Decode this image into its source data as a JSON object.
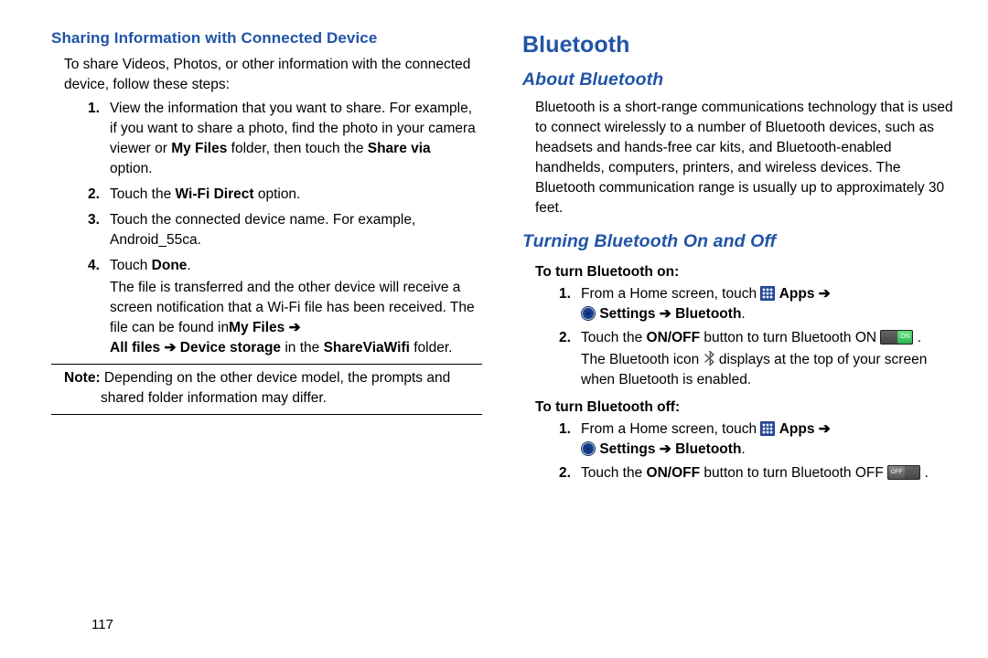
{
  "left": {
    "heading": "Sharing Information with Connected Device",
    "intro": "To share Videos, Photos, or other information with the connected device, follow these steps:",
    "step1": "View the information that you want to share. For example, if you want to share a photo, find the photo in your camera viewer or ",
    "myFiles": "My Files",
    "step1b": " folder, then touch the ",
    "shareVia": "Share via",
    "step1c": " option.",
    "step2a": "Touch the ",
    "wifiDirect": "Wi-Fi Direct",
    "step2b": " option.",
    "step3": "Touch the connected device name. For example, Android_55ca.",
    "step4a": "Touch ",
    "done": "Done",
    "step4b": ".",
    "step4cont": "The file is transferred and the other device will receive a screen notification that a Wi-Fi file has been received. The file can be found in",
    "myFiles2": "My Files",
    "arrow": "➔",
    "allFiles": "All files",
    "deviceStorage": "Device storage",
    "inThe": " in the ",
    "shareViaWifi": "ShareViaWifi",
    "folder": " folder.",
    "noteLabel": "Note: ",
    "noteFirst": "Depending on the other device model, the prompts and",
    "noteBody": "shared folder information may differ.",
    "pageNum": "117"
  },
  "right": {
    "main": "Bluetooth",
    "about": "About Bluetooth",
    "aboutText": "Bluetooth is a short-range communications technology that is used to connect wirelessly to a number of Bluetooth devices, such as headsets and hands-free car kits, and Bluetooth-enabled handhelds, computers, printers, and wireless devices. The Bluetooth communication range is usually up to approximately 30 feet.",
    "turning": "Turning Bluetooth On and Off",
    "toOn": "To turn Bluetooth on:",
    "fromHome": "From a Home screen, touch ",
    "apps": "Apps",
    "settings": "Settings",
    "bluetooth": "Bluetooth",
    "touchThe": "Touch the ",
    "onoff": "ON/OFF",
    "toTurnOn": " button to turn Bluetooth ON ",
    "btIconTxt": "The Bluetooth icon ",
    "displaysTop": " displays at the top of your screen when Bluetooth is enabled.",
    "toOff": "To turn Bluetooth off:",
    "toTurnOff": " button to turn Bluetooth OFF ",
    "onKnob": "ON",
    "offKnob": "OFF"
  }
}
